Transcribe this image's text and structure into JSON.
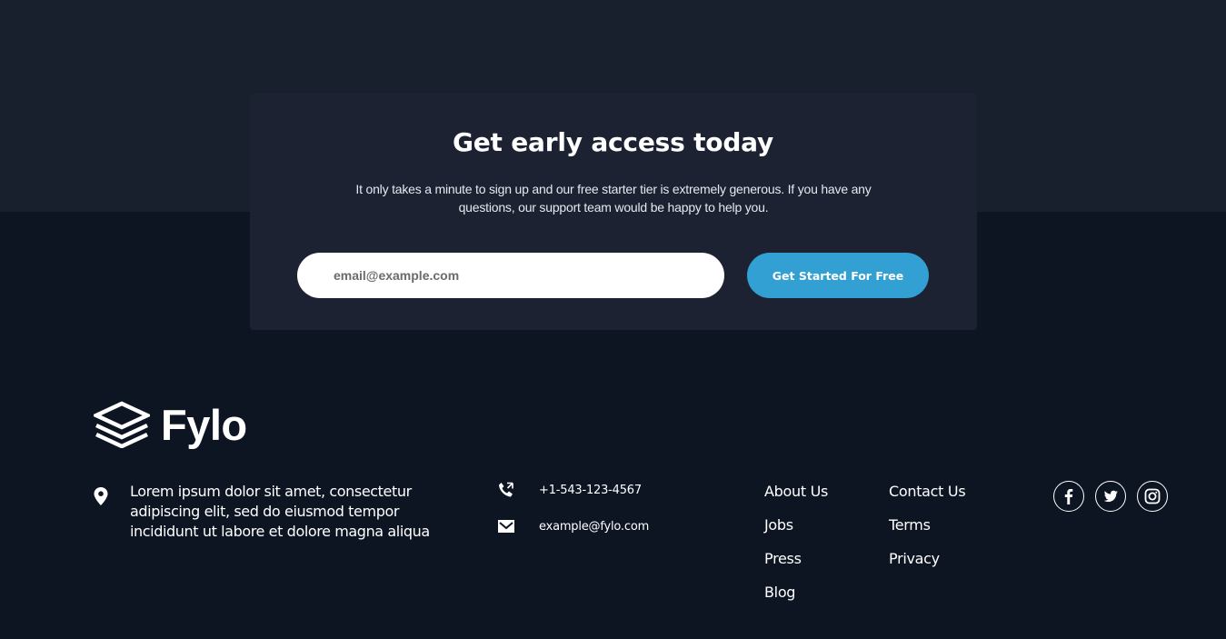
{
  "cta": {
    "title": "Get early access today",
    "description": "It only takes a minute to sign up and our free starter tier is extremely generous. If you have any questions, our support team would be happy to help you.",
    "email_placeholder": "email@example.com",
    "button_label": "Get Started For Free"
  },
  "brand": {
    "name": "Fylo"
  },
  "footer": {
    "address": "Lorem ipsum dolor sit amet, consectetur adipiscing elit, sed do eiusmod tempor incididunt ut labore et dolore magna aliqua",
    "phone": "+1-543-123-4567",
    "email": "example@fylo.com",
    "links_col1": [
      "About Us",
      "Jobs",
      "Press",
      "Blog"
    ],
    "links_col2": [
      "Contact Us",
      "Terms",
      "Privacy"
    ],
    "social": [
      "facebook-icon",
      "twitter-icon",
      "instagram-icon"
    ]
  },
  "colors": {
    "top_band": "#181f2d",
    "page_bg": "#0d1523",
    "card_bg": "#1c2232",
    "accent": "#33a0d3"
  }
}
